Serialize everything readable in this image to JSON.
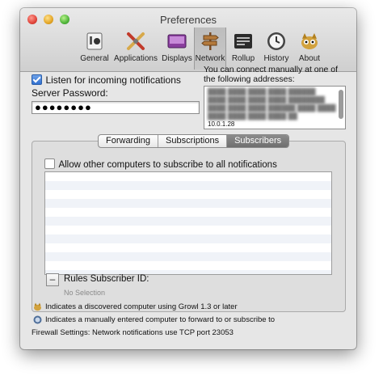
{
  "window": {
    "title": "Preferences"
  },
  "toolbar": {
    "items": [
      {
        "label": "General",
        "icon": "general-icon"
      },
      {
        "label": "Applications",
        "icon": "applications-icon"
      },
      {
        "label": "Displays",
        "icon": "displays-icon"
      },
      {
        "label": "Network",
        "icon": "network-icon"
      },
      {
        "label": "Rollup",
        "icon": "rollup-icon"
      },
      {
        "label": "History",
        "icon": "history-icon"
      },
      {
        "label": "About",
        "icon": "about-icon"
      }
    ],
    "selected": "Network"
  },
  "network": {
    "listen_label": "Listen for incoming notifications",
    "listen_checked": true,
    "password_label": "Server Password:",
    "password_value": "●●●●●●●●",
    "connect_hint": "You can connect manually at one of the following addresses:",
    "addresses_visible": "10.0.1.28"
  },
  "tabs": {
    "forwarding": "Forwarding",
    "subscriptions": "Subscriptions",
    "subscribers": "Subscribers",
    "active": "Subscribers"
  },
  "subscribers": {
    "allow_label": "Allow other computers to subscribe to all notifications",
    "allow_checked": false,
    "minus_label": "–",
    "rules_label": "Rules Subscriber ID:",
    "no_selection": "No Selection"
  },
  "legend": {
    "discovered": "Indicates a discovered computer using Growl 1.3 or later",
    "manual": "Indicates a manually entered computer to forward to or subscribe to"
  },
  "firewall": "Firewall Settings: Network notifications use TCP port 23053",
  "colors": {
    "accent": "#2f6fd0",
    "selected_segment": "#7a7a7a",
    "window_bg": "#e6e6e6"
  }
}
